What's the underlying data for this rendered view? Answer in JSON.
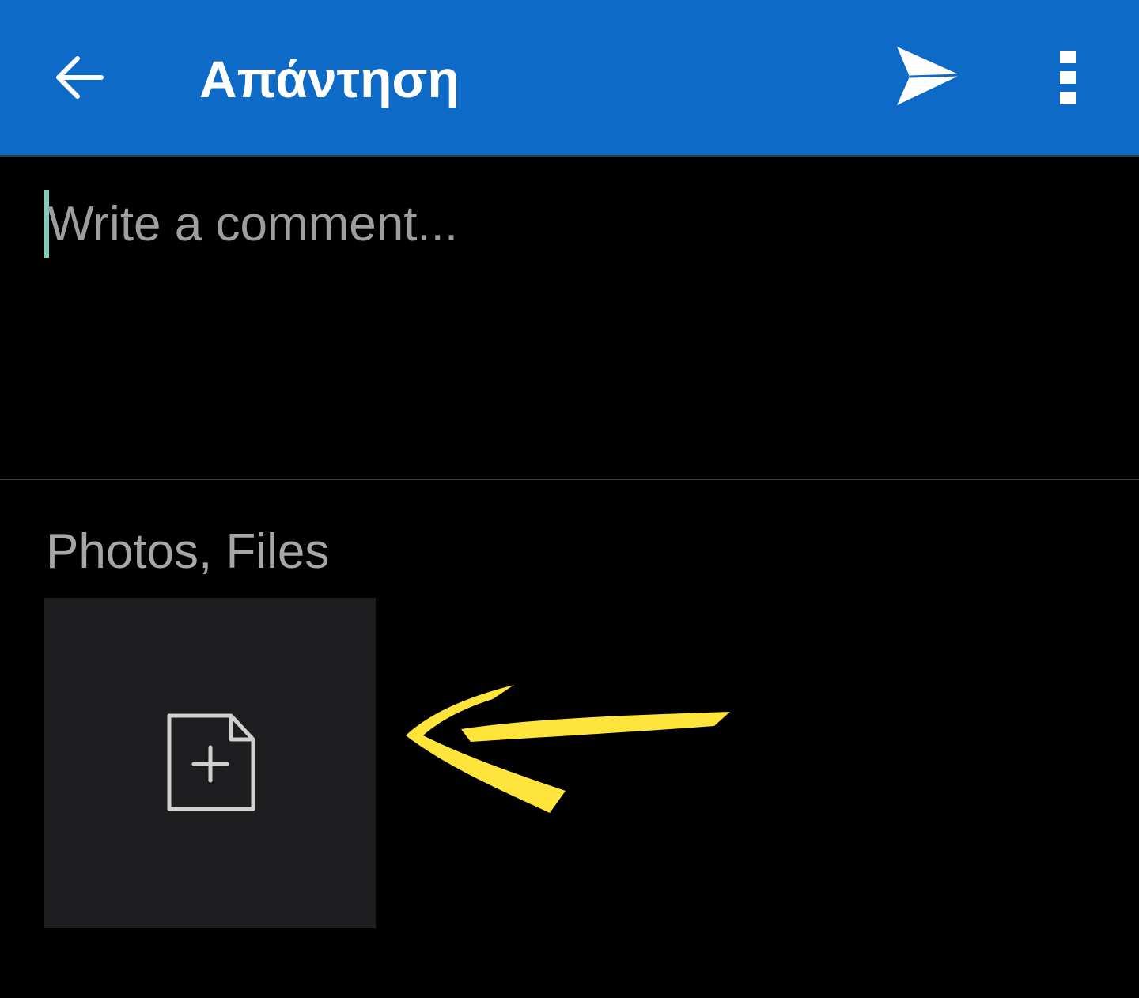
{
  "app_bar": {
    "title": "Απάντηση",
    "background_color": "#0d6ac7",
    "back_icon": "arrow-left-icon",
    "send_icon": "send-icon",
    "more_icon": "more-vertical-icon"
  },
  "comment": {
    "placeholder": "Write a comment...",
    "value": "",
    "caret_color": "#7fcfc0"
  },
  "attachments": {
    "label": "Photos, Files",
    "add_icon": "file-add-icon",
    "tile_color": "#1e1e20"
  },
  "annotation": {
    "arrow_icon": "hand-drawn-arrow-icon",
    "color": "#ffe53b"
  }
}
